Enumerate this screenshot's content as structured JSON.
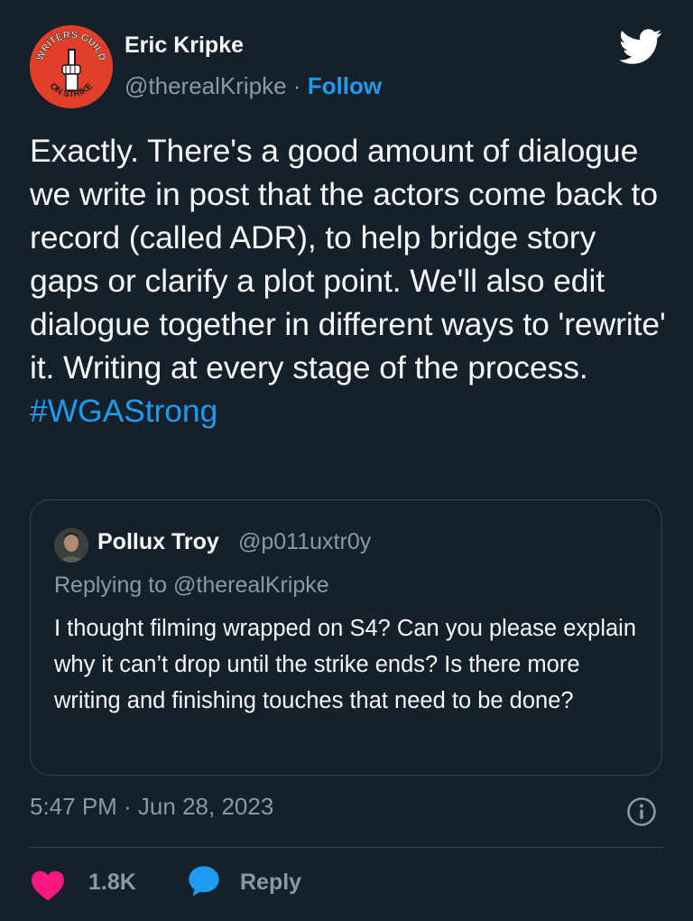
{
  "author": {
    "name": "Eric Kripke",
    "handle": "@therealKripke",
    "separator": "·",
    "follow_label": "Follow",
    "avatar_badge": {
      "top_text": "WRITERS GUILD",
      "bottom_text": "ON STRIKE",
      "color": "#e23f2b"
    }
  },
  "tweet": {
    "text": "Exactly. There's a good amount of dialogue we write in post that the actors come back to record (called ADR), to help bridge story gaps or clarify a plot point. We'll also edit dialogue together in different ways to 'rewrite' it. Writing at every stage of the process. ",
    "hashtag": "#WGAStrong",
    "timestamp": "5:47 PM · Jun 28, 2023"
  },
  "quoted_tweet": {
    "name": "Pollux Troy",
    "handle": "@p011uxtr0y",
    "replying_to": "Replying to @therealKripke",
    "text": "I thought filming wrapped on S4? Can you please explain why it can’t drop until the strike ends? Is there more writing and finishing touches that need to be done?"
  },
  "actions": {
    "like_count": "1.8K",
    "reply_label": "Reply"
  },
  "icons": {
    "brand": "twitter-bird-icon",
    "info": "info-icon",
    "like": "heart-icon",
    "reply": "speech-bubble-icon"
  },
  "colors": {
    "background": "#15202b",
    "accent": "#1d9bf0",
    "like": "#f91880",
    "muted": "#8b98a5",
    "border": "#38444d"
  }
}
